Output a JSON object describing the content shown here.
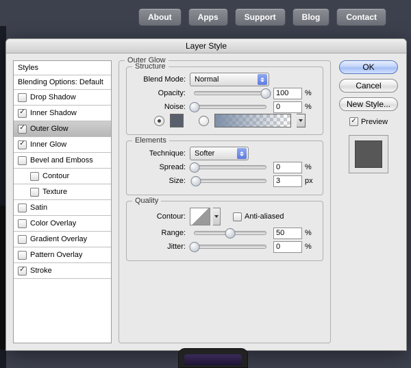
{
  "nav": {
    "items": [
      "About",
      "Apps",
      "Support",
      "Blog",
      "Contact"
    ]
  },
  "dialog": {
    "title": "Layer Style",
    "ok": "OK",
    "cancel": "Cancel",
    "newStyle": "New Style...",
    "previewLabel": "Preview"
  },
  "styles": {
    "header": "Styles",
    "blending": "Blending Options: Default",
    "items": [
      {
        "label": "Drop Shadow",
        "checked": false,
        "selected": false
      },
      {
        "label": "Inner Shadow",
        "checked": true,
        "selected": false
      },
      {
        "label": "Outer Glow",
        "checked": true,
        "selected": true
      },
      {
        "label": "Inner Glow",
        "checked": true,
        "selected": false
      },
      {
        "label": "Bevel and Emboss",
        "checked": false,
        "selected": false
      },
      {
        "label": "Contour",
        "checked": false,
        "selected": false,
        "indent": true
      },
      {
        "label": "Texture",
        "checked": false,
        "selected": false,
        "indent": true
      },
      {
        "label": "Satin",
        "checked": false,
        "selected": false
      },
      {
        "label": "Color Overlay",
        "checked": false,
        "selected": false
      },
      {
        "label": "Gradient Overlay",
        "checked": false,
        "selected": false
      },
      {
        "label": "Pattern Overlay",
        "checked": false,
        "selected": false
      },
      {
        "label": "Stroke",
        "checked": true,
        "selected": false
      }
    ]
  },
  "panel": {
    "groupTitle": "Outer Glow",
    "structure": {
      "title": "Structure",
      "blendModeLabel": "Blend Mode:",
      "blendMode": "Normal",
      "opacityLabel": "Opacity:",
      "opacity": "100",
      "opacityUnit": "%",
      "noiseLabel": "Noise:",
      "noise": "0",
      "noiseUnit": "%",
      "solidColor": "#5a5f6c",
      "gradientStart": "#7e8fa8"
    },
    "elements": {
      "title": "Elements",
      "techniqueLabel": "Technique:",
      "technique": "Softer",
      "spreadLabel": "Spread:",
      "spread": "0",
      "spreadUnit": "%",
      "sizeLabel": "Size:",
      "size": "3",
      "sizeUnit": "px"
    },
    "quality": {
      "title": "Quality",
      "contourLabel": "Contour:",
      "aaLabel": "Anti-aliased",
      "rangeLabel": "Range:",
      "range": "50",
      "rangeUnit": "%",
      "jitterLabel": "Jitter:",
      "jitter": "0",
      "jitterUnit": "%"
    }
  }
}
